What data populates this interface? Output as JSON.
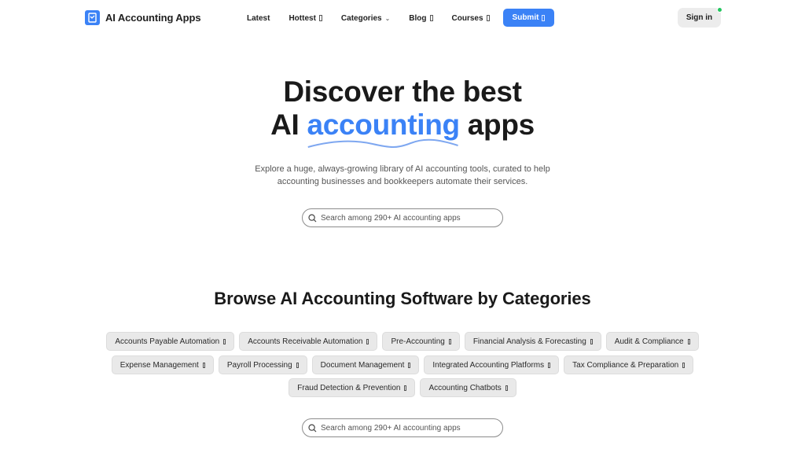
{
  "brand": {
    "name": "AI Accounting Apps",
    "accent_color": "#3b82f6"
  },
  "nav": {
    "items": [
      {
        "label": "Latest",
        "icon": ""
      },
      {
        "label": "Hottest",
        "icon": "external-link-icon"
      },
      {
        "label": "Categories",
        "icon": "chevron-down-icon"
      },
      {
        "label": "Blog",
        "icon": "external-link-icon"
      },
      {
        "label": "Courses",
        "icon": "external-link-icon"
      }
    ],
    "submit_label": "Submit",
    "signin_label": "Sign in"
  },
  "hero": {
    "title_line1": "Discover the best",
    "title_pre": "AI ",
    "title_accent": "accounting",
    "title_post": " apps",
    "subtitle": "Explore a huge, always-growing library of AI accounting tools, curated to help accounting businesses and bookkeepers automate their services.",
    "search_placeholder": "Search among 290+ AI accounting apps"
  },
  "categories": {
    "title": "Browse AI Accounting Software by Categories",
    "rows": [
      [
        "Accounts Payable Automation",
        "Accounts Receivable Automation",
        "Pre-Accounting",
        "Financial Analysis & Forecasting",
        "Audit & Compliance"
      ],
      [
        "Expense Management",
        "Payroll Processing",
        "Document Management",
        "Integrated Accounting Platforms",
        "Tax Compliance & Preparation"
      ],
      [
        "Fraud Detection & Prevention",
        "Accounting Chatbots"
      ]
    ]
  },
  "bottom_search": {
    "placeholder": "Search among 290+ AI accounting apps"
  }
}
